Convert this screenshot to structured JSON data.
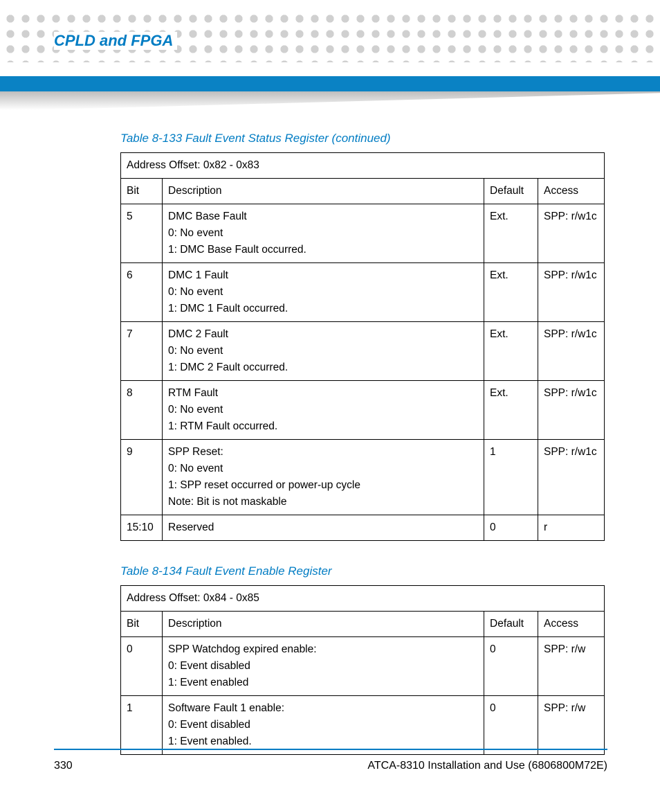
{
  "header": {
    "chapter_title": "CPLD and FPGA"
  },
  "tables": [
    {
      "caption": "Table 8-133 Fault Event Status Register (continued)",
      "address_offset": "Address Offset: 0x82 - 0x83",
      "columns": {
        "bit": "Bit",
        "desc": "Description",
        "def": "Default",
        "acc": "Access"
      },
      "rows": [
        {
          "bit": "5",
          "desc": "DMC Base Fault\n0: No event\n1: DMC Base Fault occurred.",
          "def": "Ext.",
          "acc": "SPP: r/w1c"
        },
        {
          "bit": "6",
          "desc": "DMC 1 Fault\n0: No event\n1: DMC 1 Fault occurred.",
          "def": "Ext.",
          "acc": "SPP: r/w1c"
        },
        {
          "bit": "7",
          "desc": "DMC 2 Fault\n0: No event\n1: DMC 2 Fault occurred.",
          "def": "Ext.",
          "acc": "SPP: r/w1c"
        },
        {
          "bit": "8",
          "desc": "RTM Fault\n0: No event\n1: RTM Fault occurred.",
          "def": "Ext.",
          "acc": "SPP: r/w1c"
        },
        {
          "bit": "9",
          "desc": "SPP Reset:\n0: No event\n1: SPP reset occurred or power-up cycle\nNote: Bit is not maskable",
          "def": "1",
          "acc": "SPP: r/w1c"
        },
        {
          "bit": "15:10",
          "desc": "Reserved",
          "def": "0",
          "acc": "r"
        }
      ]
    },
    {
      "caption": "Table 8-134 Fault Event Enable Register",
      "address_offset": "Address Offset: 0x84 - 0x85",
      "columns": {
        "bit": "Bit",
        "desc": "Description",
        "def": "Default",
        "acc": "Access"
      },
      "rows": [
        {
          "bit": "0",
          "desc": "SPP Watchdog expired enable:\n0: Event disabled\n1: Event enabled",
          "def": "0",
          "acc": "SPP: r/w"
        },
        {
          "bit": "1",
          "desc": "Software Fault 1 enable:\n0: Event disabled\n1: Event enabled.",
          "def": "0",
          "acc": "SPP: r/w"
        }
      ]
    }
  ],
  "footer": {
    "page_number": "330",
    "doc_title": "ATCA-8310 Installation and Use (6806800M72E)"
  }
}
